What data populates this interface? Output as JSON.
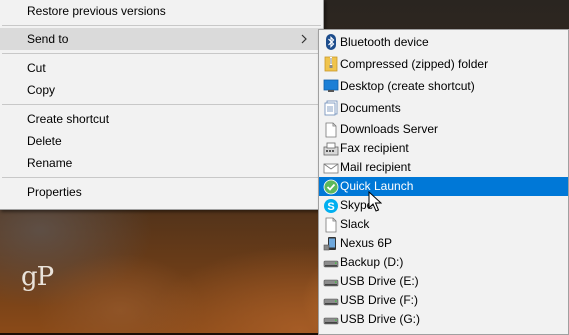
{
  "brand": {
    "text": "gP"
  },
  "context_menu": {
    "items": [
      {
        "label": "Restore previous versions"
      },
      {
        "label": "Send to"
      },
      {
        "label": "Cut"
      },
      {
        "label": "Copy"
      },
      {
        "label": "Create shortcut"
      },
      {
        "label": "Delete"
      },
      {
        "label": "Rename"
      },
      {
        "label": "Properties"
      }
    ]
  },
  "send_to_menu": {
    "items": [
      {
        "label": "Bluetooth device",
        "icon": "bluetooth-icon"
      },
      {
        "label": "Compressed (zipped) folder",
        "icon": "zip-folder-icon"
      },
      {
        "label": "Desktop (create shortcut)",
        "icon": "desktop-icon"
      },
      {
        "label": "Documents",
        "icon": "documents-icon"
      },
      {
        "label": "Downloads Server",
        "icon": "file-icon"
      },
      {
        "label": "Fax recipient",
        "icon": "fax-icon"
      },
      {
        "label": "Mail recipient",
        "icon": "mail-icon"
      },
      {
        "label": "Quick Launch",
        "icon": "checkmark-icon"
      },
      {
        "label": "Skype",
        "icon": "skype-icon"
      },
      {
        "label": "Slack",
        "icon": "file-icon"
      },
      {
        "label": "Nexus 6P",
        "icon": "phone-icon"
      },
      {
        "label": "Backup (D:)",
        "icon": "drive-icon"
      },
      {
        "label": "USB Drive (E:)",
        "icon": "drive-icon"
      },
      {
        "label": "USB Drive (F:)",
        "icon": "drive-icon"
      },
      {
        "label": "USB Drive (G:)",
        "icon": "drive-icon"
      }
    ]
  },
  "colors": {
    "highlight": "#0078d7",
    "menu_bg": "#f2f2f2",
    "hover_bg": "#dadada"
  }
}
